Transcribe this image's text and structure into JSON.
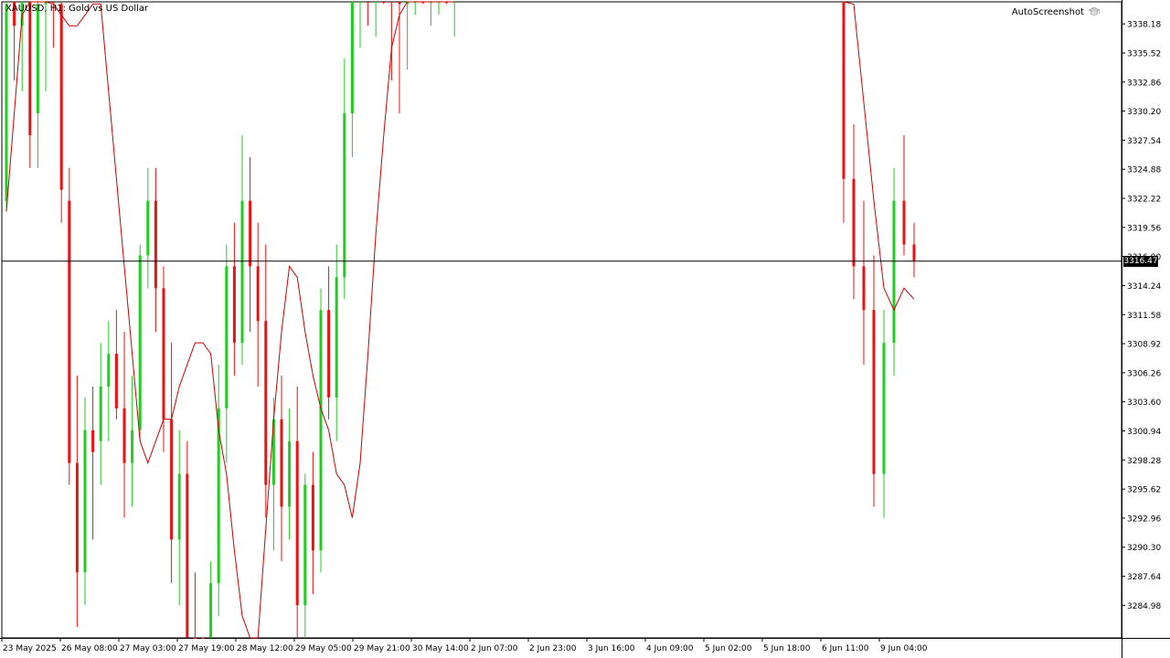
{
  "header": {
    "symbol_caption": "XAUUSD, H1:  Gold vs US Dollar",
    "plugin_label": "AutoScreenshot"
  },
  "colors": {
    "bull": "#22cc22",
    "bear": "#ee1111",
    "ma": "#cc0000",
    "axis": "#000000",
    "background": "#ffffff"
  },
  "icons": {
    "plugin": "graduation-cap-icon"
  },
  "chart_data": {
    "type": "candlestick",
    "symbol": "XAUUSD",
    "timeframe": "H1",
    "current_price": 3316.47,
    "current_price_label": "3316.47",
    "ylim": [
      3282.0,
      3340.2
    ],
    "y_ticks": [
      3338.18,
      3335.52,
      3332.86,
      3330.2,
      3327.54,
      3324.88,
      3322.22,
      3319.56,
      3316.9,
      3314.24,
      3311.58,
      3308.92,
      3306.26,
      3303.6,
      3300.94,
      3298.28,
      3295.62,
      3292.96,
      3290.3,
      3287.64,
      3284.98
    ],
    "y_tick_labels": [
      "3338.18",
      "3335.52",
      "3332.86",
      "3330.20",
      "3327.54",
      "3324.88",
      "3322.22",
      "3319.56",
      "3316.90",
      "3314.24",
      "3311.58",
      "3308.92",
      "3306.26",
      "3303.60",
      "3300.94",
      "3298.28",
      "3295.62",
      "3292.96",
      "3290.30",
      "3287.64",
      "3284.98"
    ],
    "x_tick_labels": [
      "23 May 2025",
      "26 May 08:00",
      "27 May 03:00",
      "27 May 19:00",
      "28 May 12:00",
      "29 May 05:00",
      "29 May 21:00",
      "30 May 14:00",
      "2 Jun 07:00",
      "2 Jun 23:00",
      "3 Jun 16:00",
      "4 Jun 09:00",
      "5 Jun 02:00",
      "5 Jun 18:00",
      "6 Jun 11:00",
      "9 Jun 04:00"
    ],
    "indicator": {
      "type": "moving-average",
      "values": [
        3321,
        3330,
        3339,
        3344,
        3344,
        3343,
        3340,
        3339,
        3338,
        3338,
        3339,
        3340,
        3340,
        3332,
        3324,
        3316,
        3308,
        3300,
        3298,
        3300,
        3302,
        3302,
        3305,
        3307,
        3309,
        3309,
        3308,
        3301,
        3297,
        3290,
        3284,
        3280,
        3282,
        3292,
        3302,
        3310,
        3316,
        3315,
        3310,
        3306,
        3303,
        3301,
        3297,
        3296,
        3293,
        3298,
        3308,
        3319,
        3328,
        3336,
        3339,
        3341,
        3342,
        3342,
        3342,
        3342,
        3341,
        3341,
        3345,
        3340,
        3331,
        3322,
        3314,
        3312,
        3314,
        3313
      ]
    },
    "candles": [
      {
        "o": 3322,
        "h": 3345,
        "l": 3321,
        "c": 3340
      },
      {
        "o": 3341,
        "h": 3348,
        "l": 3333,
        "c": 3338
      },
      {
        "o": 3338,
        "h": 3345,
        "l": 3332,
        "c": 3343
      },
      {
        "o": 3341,
        "h": 3344,
        "l": 3325,
        "c": 3328
      },
      {
        "o": 3330,
        "h": 3342,
        "l": 3325,
        "c": 3340
      },
      {
        "o": 3340,
        "h": 3348,
        "l": 3332,
        "c": 3344
      },
      {
        "o": 3344,
        "h": 3350,
        "l": 3336,
        "c": 3341
      },
      {
        "o": 3340,
        "h": 3347,
        "l": 3320,
        "c": 3323
      },
      {
        "o": 3322,
        "h": 3325,
        "l": 3296,
        "c": 3298
      },
      {
        "o": 3298,
        "h": 3306,
        "l": 3283,
        "c": 3288
      },
      {
        "o": 3288,
        "h": 3304,
        "l": 3285,
        "c": 3301
      },
      {
        "o": 3301,
        "h": 3305,
        "l": 3291,
        "c": 3299
      },
      {
        "o": 3300,
        "h": 3309,
        "l": 3296,
        "c": 3305
      },
      {
        "o": 3305,
        "h": 3311,
        "l": 3300,
        "c": 3308
      },
      {
        "o": 3308,
        "h": 3312,
        "l": 3302,
        "c": 3303
      },
      {
        "o": 3303,
        "h": 3310,
        "l": 3293,
        "c": 3298
      },
      {
        "o": 3298,
        "h": 3306,
        "l": 3294,
        "c": 3301
      },
      {
        "o": 3301,
        "h": 3318,
        "l": 3300,
        "c": 3317
      },
      {
        "o": 3317,
        "h": 3325,
        "l": 3314,
        "c": 3322
      },
      {
        "o": 3322,
        "h": 3325,
        "l": 3310,
        "c": 3314
      },
      {
        "o": 3314,
        "h": 3316,
        "l": 3299,
        "c": 3302
      },
      {
        "o": 3302,
        "h": 3309,
        "l": 3287,
        "c": 3291
      },
      {
        "o": 3291,
        "h": 3301,
        "l": 3285,
        "c": 3297
      },
      {
        "o": 3297,
        "h": 3300,
        "l": 3280,
        "c": 3282
      },
      {
        "o": 3282,
        "h": 3288,
        "l": 3272,
        "c": 3276
      },
      {
        "o": 3276,
        "h": 3279,
        "l": 3270,
        "c": 3274
      },
      {
        "o": 3275,
        "h": 3289,
        "l": 3272,
        "c": 3287
      },
      {
        "o": 3287,
        "h": 3307,
        "l": 3284,
        "c": 3303
      },
      {
        "o": 3303,
        "h": 3318,
        "l": 3298,
        "c": 3316
      },
      {
        "o": 3316,
        "h": 3320,
        "l": 3306,
        "c": 3309
      },
      {
        "o": 3309,
        "h": 3328,
        "l": 3307,
        "c": 3322
      },
      {
        "o": 3322,
        "h": 3326,
        "l": 3310,
        "c": 3316
      },
      {
        "o": 3316,
        "h": 3320,
        "l": 3305,
        "c": 3311
      },
      {
        "o": 3311,
        "h": 3318,
        "l": 3293,
        "c": 3296
      },
      {
        "o": 3296,
        "h": 3304,
        "l": 3290,
        "c": 3302
      },
      {
        "o": 3302,
        "h": 3306,
        "l": 3289,
        "c": 3294
      },
      {
        "o": 3294,
        "h": 3303,
        "l": 3291,
        "c": 3300
      },
      {
        "o": 3300,
        "h": 3305,
        "l": 3282,
        "c": 3285
      },
      {
        "o": 3285,
        "h": 3297,
        "l": 3280,
        "c": 3296
      },
      {
        "o": 3296,
        "h": 3299,
        "l": 3286,
        "c": 3290
      },
      {
        "o": 3290,
        "h": 3314,
        "l": 3288,
        "c": 3312
      },
      {
        "o": 3312,
        "h": 3316,
        "l": 3302,
        "c": 3304
      },
      {
        "o": 3304,
        "h": 3318,
        "l": 3300,
        "c": 3315
      },
      {
        "o": 3315,
        "h": 3335,
        "l": 3313,
        "c": 3330
      },
      {
        "o": 3330,
        "h": 3345,
        "l": 3326,
        "c": 3342
      },
      {
        "o": 3342,
        "h": 3350,
        "l": 3336,
        "c": 3344
      },
      {
        "o": 3344,
        "h": 3352,
        "l": 3338,
        "c": 3341
      },
      {
        "o": 3341,
        "h": 3350,
        "l": 3337,
        "c": 3348
      },
      {
        "o": 3348,
        "h": 3352,
        "l": 3340,
        "c": 3345
      },
      {
        "o": 3345,
        "h": 3350,
        "l": 3333,
        "c": 3341
      },
      {
        "o": 3341,
        "h": 3344,
        "l": 3330,
        "c": 3340
      },
      {
        "o": 3340,
        "h": 3342,
        "l": 3334,
        "c": 3341
      },
      {
        "o": 3341,
        "h": 3344,
        "l": 3339,
        "c": 3342
      },
      {
        "o": 3342,
        "h": 3345,
        "l": 3340,
        "c": 3341
      },
      {
        "o": 3341,
        "h": 3346,
        "l": 3338,
        "c": 3342
      },
      {
        "o": 3342,
        "h": 3348,
        "l": 3339,
        "c": 3345
      },
      {
        "o": 3345,
        "h": 3350,
        "l": 3340,
        "c": 3341
      },
      {
        "o": 3341,
        "h": 3347,
        "l": 3337,
        "c": 3344
      },
      {
        "o": 3344,
        "h": 3350,
        "l": 3320,
        "c": 3324
      },
      {
        "o": 3324,
        "h": 3329,
        "l": 3313,
        "c": 3316
      },
      {
        "o": 3316,
        "h": 3322,
        "l": 3307,
        "c": 3312
      },
      {
        "o": 3312,
        "h": 3317,
        "l": 3294,
        "c": 3297
      },
      {
        "o": 3297,
        "h": 3312,
        "l": 3293,
        "c": 3309
      },
      {
        "o": 3309,
        "h": 3325,
        "l": 3306,
        "c": 3322
      },
      {
        "o": 3322,
        "h": 3328,
        "l": 3317,
        "c": 3318
      },
      {
        "o": 3318,
        "h": 3320,
        "l": 3315,
        "c": 3316.47
      }
    ]
  }
}
